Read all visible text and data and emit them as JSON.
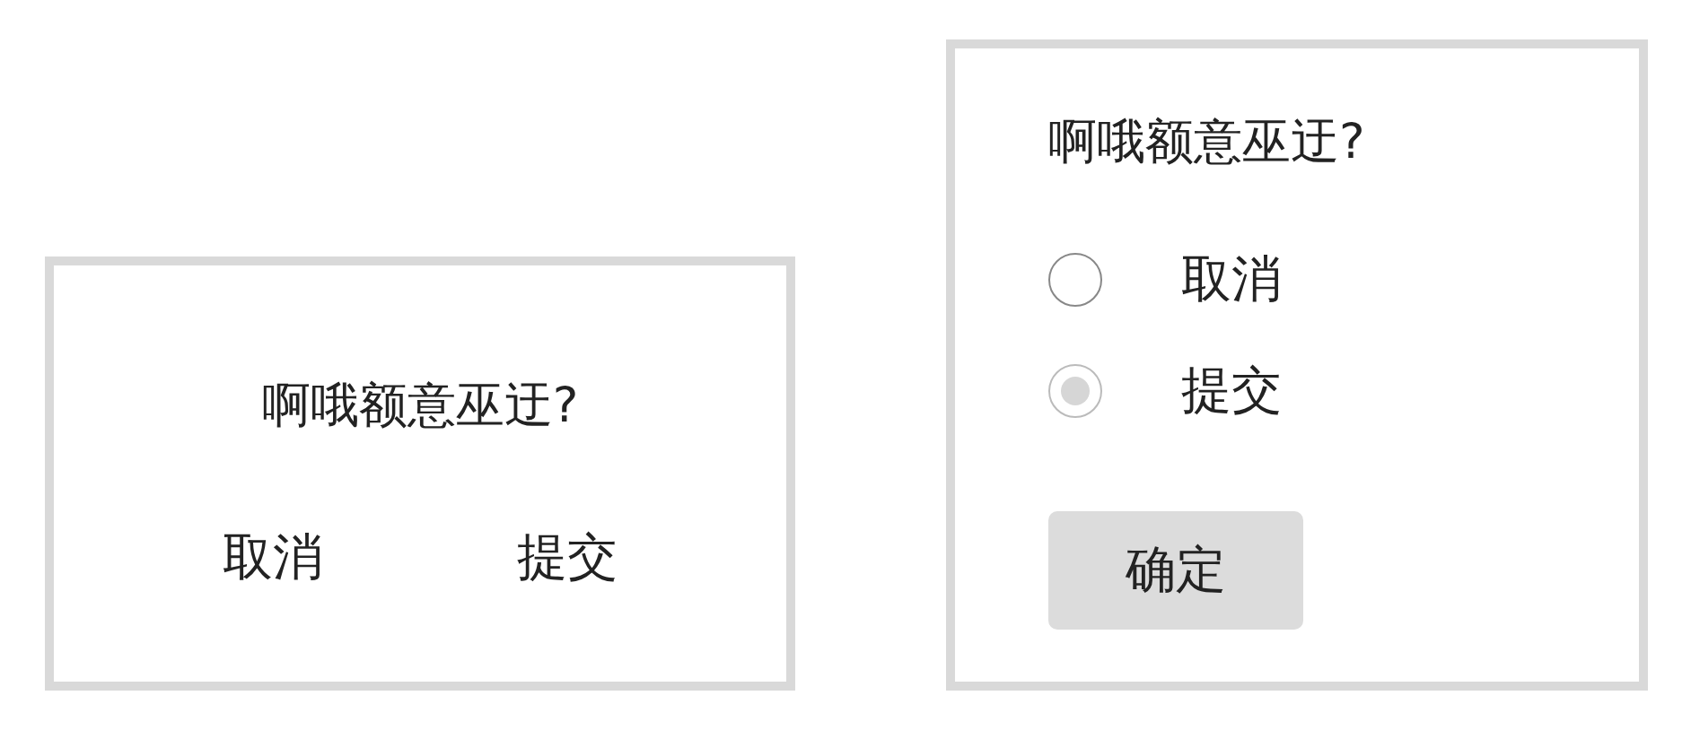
{
  "dialogs": [
    {
      "kind": "buttons",
      "question": "啊哦额意巫迂?",
      "buttons": [
        "取消",
        "提交"
      ]
    },
    {
      "kind": "radio",
      "question": "啊哦额意巫迂?",
      "options": [
        {
          "label": "取消",
          "selected": false
        },
        {
          "label": "提交",
          "selected": true
        }
      ],
      "confirm": "确定"
    }
  ]
}
